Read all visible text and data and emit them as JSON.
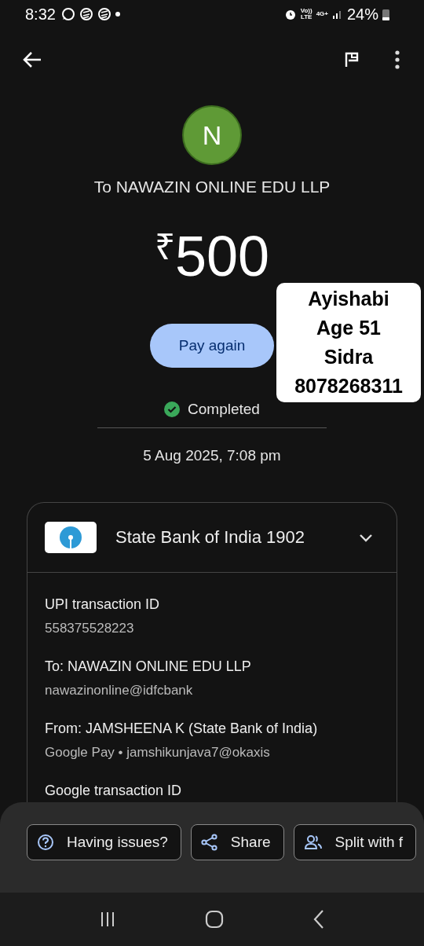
{
  "status_bar": {
    "time": "8:32",
    "network_voice": "Vo))",
    "network_voice_sub": "LTE",
    "network_data": "4G+",
    "battery": "24%"
  },
  "payee": {
    "initial": "N",
    "title": "To NAWAZIN ONLINE EDU LLP"
  },
  "amount": {
    "currency": "₹",
    "value": "500"
  },
  "pay_again_button": "Pay again",
  "status": {
    "label": "Completed"
  },
  "date": "5 Aug 2025, 7:08 pm",
  "account_card": {
    "bank": "State Bank of India 1902",
    "expanded": true,
    "details": [
      {
        "label": "UPI transaction ID",
        "value": "558375528223"
      },
      {
        "label": "To: NAWAZIN ONLINE EDU LLP",
        "value": "nawazinonline@idfcbank"
      },
      {
        "label": "From: JAMSHEENA  K (State Bank of India)",
        "value": "Google Pay • jamshikunjava7@okaxis"
      },
      {
        "label": "Google transaction ID"
      }
    ]
  },
  "actions": [
    {
      "kind": "help",
      "label": "Having issues?"
    },
    {
      "kind": "share",
      "label": "Share"
    },
    {
      "kind": "split",
      "label": "Split with f"
    }
  ],
  "sticker": {
    "lines": [
      "Ayishabi",
      "Age 51",
      "Sidra",
      "8078268311"
    ]
  }
}
